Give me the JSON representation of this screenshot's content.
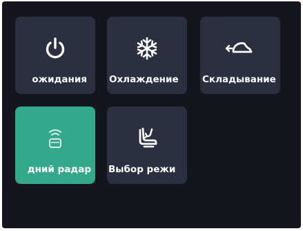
{
  "tiles": [
    {
      "label": "ожидания",
      "icon": "power-icon",
      "active": false
    },
    {
      "label": "Охлаждение",
      "icon": "snowflake-icon",
      "active": false
    },
    {
      "label": "Складывание",
      "icon": "fold-mirror-icon",
      "active": false
    },
    {
      "label": "дний радар",
      "icon": "radar-icon",
      "active": true
    },
    {
      "label": "Выбор режи",
      "icon": "seat-icon",
      "active": false
    }
  ],
  "colors": {
    "screen_bg": "#15151d",
    "tile_bg": "#2c2f40",
    "tile_active_bg": "#33a88a",
    "text": "#ffffff"
  }
}
